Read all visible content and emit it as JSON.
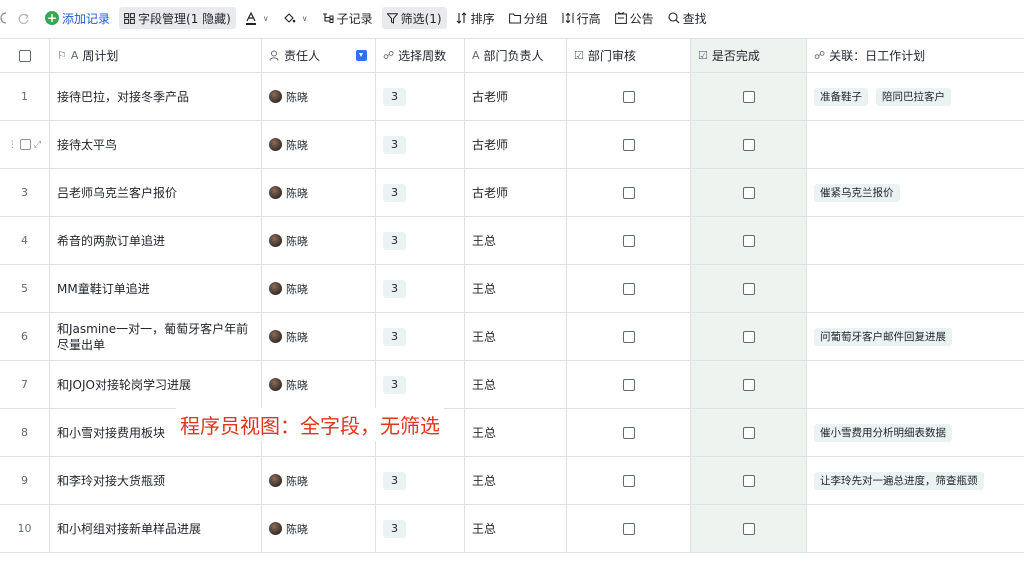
{
  "toolbar": {
    "add_record": "添加记录",
    "field_manage": "字段管理(1 隐藏)",
    "sub_record": "子记录",
    "filter": "筛选(1)",
    "sort": "排序",
    "group": "分组",
    "row_height": "行高",
    "notice": "公告",
    "find": "查找"
  },
  "columns": {
    "weekly_plan": "周计划",
    "owner": "责任人",
    "week": "选择周数",
    "dept_head": "部门负责人",
    "dept_review": "部门审核",
    "done": "是否完成",
    "link": "关联：日工作计划"
  },
  "rows": [
    {
      "num": "1",
      "plan": "接待巴拉，对接冬季产品",
      "owner": "陈晓",
      "week": "3",
      "head": "古老师",
      "links": [
        "准备鞋子",
        "陪同巴拉客户"
      ]
    },
    {
      "num": "",
      "plan": "接待太平鸟",
      "owner": "陈晓",
      "week": "3",
      "head": "古老师",
      "links": []
    },
    {
      "num": "3",
      "plan": "吕老师乌克兰客户报价",
      "owner": "陈晓",
      "week": "3",
      "head": "古老师",
      "links": [
        "催紧乌克兰报价"
      ]
    },
    {
      "num": "4",
      "plan": "希音的两款订单追进",
      "owner": "陈晓",
      "week": "3",
      "head": "王总",
      "links": []
    },
    {
      "num": "5",
      "plan": "MM童鞋订单追进",
      "owner": "陈晓",
      "week": "3",
      "head": "王总",
      "links": []
    },
    {
      "num": "6",
      "plan": "和Jasmine一对一，葡萄牙客户年前尽量出单",
      "owner": "陈晓",
      "week": "3",
      "head": "王总",
      "links": [
        "问葡萄牙客户邮件回复进展"
      ]
    },
    {
      "num": "7",
      "plan": "和JOJO对接轮岗学习进展",
      "owner": "陈晓",
      "week": "3",
      "head": "王总",
      "links": []
    },
    {
      "num": "8",
      "plan": "和小雪对接费用板块",
      "owner": "",
      "week": "",
      "head": "王总",
      "links": [
        "催小雪费用分析明细表数据"
      ]
    },
    {
      "num": "9",
      "plan": "和李玲对接大货瓶颈",
      "owner": "陈晓",
      "week": "3",
      "head": "王总",
      "links": [
        "让李玲先对一遍总进度，筛查瓶颈"
      ]
    },
    {
      "num": "10",
      "plan": "和小柯组对接新单样品进展",
      "owner": "陈晓",
      "week": "3",
      "head": "王总",
      "links": []
    }
  ],
  "overlay": "程序员视图：全字段，无筛选",
  "colors": {
    "accent": "#3370ff",
    "add": "#34a853",
    "done_column": "#edf4ef",
    "tag_bg": "#eaf3f1",
    "overlay_text": "#e0351e"
  }
}
